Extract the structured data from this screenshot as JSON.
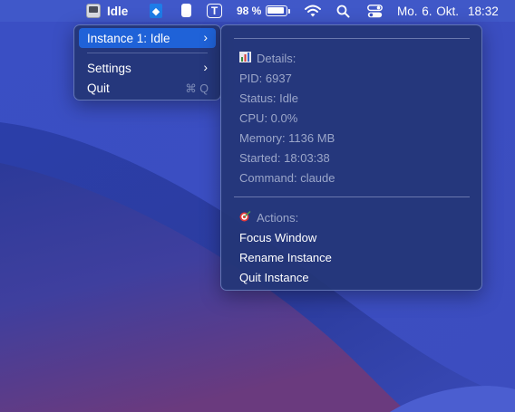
{
  "menubar": {
    "app_label": "Idle",
    "battery_percent": "98 %",
    "clock_date": "Mo. 6. Okt.",
    "clock_time": "18:32",
    "icons": [
      "app-status-icon",
      "box-icon",
      "clipboard-icon",
      "t-app-icon",
      "battery-icon",
      "wifi-icon",
      "search-icon",
      "control-center-icon"
    ]
  },
  "menu_main": {
    "items": [
      {
        "label": "Instance 1: Idle",
        "has_submenu": true,
        "selected": true
      },
      {
        "label": "Settings",
        "has_submenu": true
      },
      {
        "label": "Quit",
        "shortcut": "⌘ Q"
      }
    ]
  },
  "menu_sub": {
    "details_header": "Details:",
    "details_icon": "bar-chart-icon",
    "details": [
      "PID: 6937",
      "Status: Idle",
      "CPU: 0.0%",
      "Memory: 1136 MB",
      "Started: 18:03:38",
      "Command: claude"
    ],
    "actions_header": "Actions:",
    "actions_icon": "target-icon",
    "actions": [
      "Focus Window",
      "Rename Instance",
      "Quit Instance"
    ]
  },
  "colors": {
    "menu_bg": "#243676",
    "selection": "#1f62d8",
    "dim_text": "#9ba6c9"
  }
}
